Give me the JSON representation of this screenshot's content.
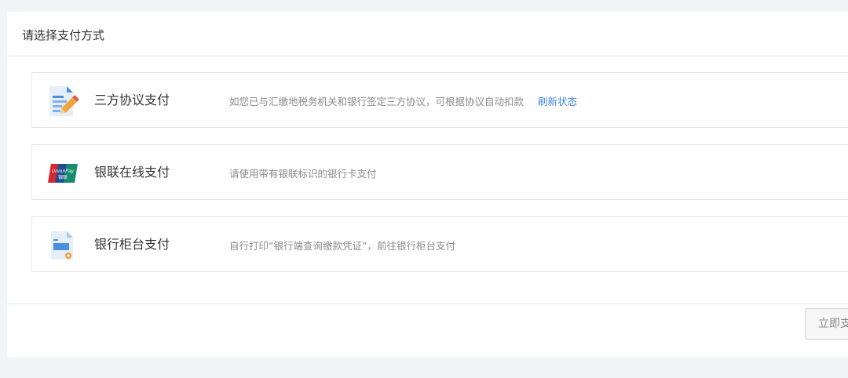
{
  "panel": {
    "title": "请选择支付方式"
  },
  "options": [
    {
      "name": "三方协议支付",
      "icon": "agreement-document-icon",
      "description": "如您已与汇缴地税务机关和银行签定三方协议，可根据协议自动扣款",
      "link": "刷新状态"
    },
    {
      "name": "银联在线支付",
      "icon": "unionpay-card-icon",
      "description": "请使用带有银联标识的银行卡支付",
      "card_logo_text": "UnionPay",
      "card_logo_cn": "银联"
    },
    {
      "name": "银行柜台支付",
      "icon": "bank-counter-document-icon",
      "description": "自行打印“银行端查询缴款凭证”，前往银行柜台支付"
    }
  ],
  "footer": {
    "pay_button": "立即支付"
  },
  "colors": {
    "page_bg": "#f3f4f7",
    "panel_bg": "#ffffff",
    "link": "#3d86e0",
    "border": "#e3e3e3"
  }
}
